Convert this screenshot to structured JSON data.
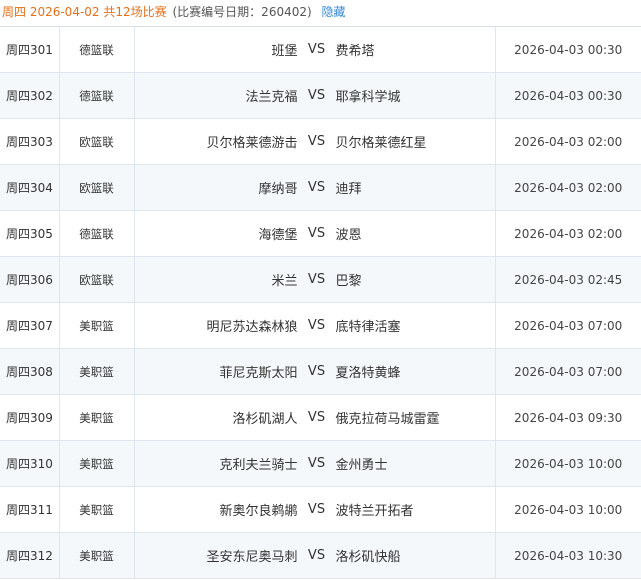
{
  "header": {
    "date_text": "周四 2026-04-02",
    "count_text": "共12场比赛",
    "issue_text": "(比赛编号日期：260402)",
    "hide_label": "隐藏"
  },
  "vs_label": "VS",
  "matches": [
    {
      "no": "周四301",
      "league": "德篮联",
      "home": "班堡",
      "away": "费希塔",
      "time": "2026-04-03 00:30"
    },
    {
      "no": "周四302",
      "league": "德篮联",
      "home": "法兰克福",
      "away": "耶拿科学城",
      "time": "2026-04-03 00:30"
    },
    {
      "no": "周四303",
      "league": "欧篮联",
      "home": "贝尔格莱德游击",
      "away": "贝尔格莱德红星",
      "time": "2026-04-03 02:00"
    },
    {
      "no": "周四304",
      "league": "欧篮联",
      "home": "摩纳哥",
      "away": "迪拜",
      "time": "2026-04-03 02:00"
    },
    {
      "no": "周四305",
      "league": "德篮联",
      "home": "海德堡",
      "away": "波恩",
      "time": "2026-04-03 02:00"
    },
    {
      "no": "周四306",
      "league": "欧篮联",
      "home": "米兰",
      "away": "巴黎",
      "time": "2026-04-03 02:45"
    },
    {
      "no": "周四307",
      "league": "美职篮",
      "home": "明尼苏达森林狼",
      "away": "底特律活塞",
      "time": "2026-04-03 07:00"
    },
    {
      "no": "周四308",
      "league": "美职篮",
      "home": "菲尼克斯太阳",
      "away": "夏洛特黄蜂",
      "time": "2026-04-03 07:00"
    },
    {
      "no": "周四309",
      "league": "美职篮",
      "home": "洛杉矶湖人",
      "away": "俄克拉荷马城雷霆",
      "time": "2026-04-03 09:30"
    },
    {
      "no": "周四310",
      "league": "美职篮",
      "home": "克利夫兰骑士",
      "away": "金州勇士",
      "time": "2026-04-03 10:00"
    },
    {
      "no": "周四311",
      "league": "美职篮",
      "home": "新奥尔良鹈鹕",
      "away": "波特兰开拓者",
      "time": "2026-04-03 10:00"
    },
    {
      "no": "周四312",
      "league": "美职篮",
      "home": "圣安东尼奥马刺",
      "away": "洛杉矶快船",
      "time": "2026-04-03 10:30"
    }
  ]
}
